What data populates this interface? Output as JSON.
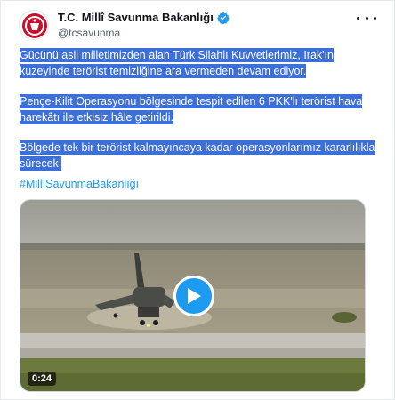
{
  "account": {
    "display_name": "T.C. Millî Savunma Bakanlığı",
    "handle": "@tcsavunma",
    "verified_icon": "verified-badge-icon",
    "avatar_icon": "ministry-seal-icon"
  },
  "menu": {
    "icon": "more-options-icon"
  },
  "tweet": {
    "paragraphs": [
      "Gücünü asil milletimizden alan Türk Silahlı Kuvvetlerimiz, Irak'ın kuzeyinde terörist temizliğine ara vermeden devam ediyor.",
      "Pençe-Kilit Operasyonu bölgesinde tespit edilen 6 PKK'lı terörist hava harekâtı ile etkisiz hâle getirildi.",
      "Bölgede tek bir terörist kalmayıncaya kadar operasyonlarımız kararlılıkla sürecek!"
    ],
    "hashtag": "#MillîSavunmaBakanlığı"
  },
  "video": {
    "duration": "0:24",
    "play_icon": "play-icon"
  },
  "colors": {
    "highlight": "#3d6fd8",
    "accent": "#1d9bf0",
    "name_text": "#0f1419",
    "secondary_text": "#536471"
  }
}
